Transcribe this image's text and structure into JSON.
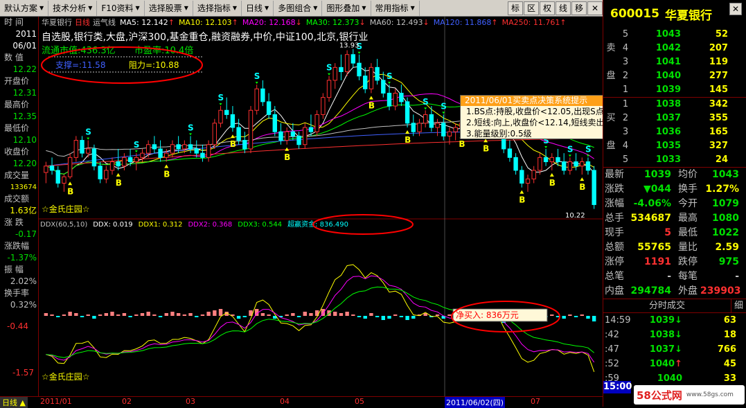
{
  "menubar": {
    "items": [
      "默认方案",
      "技术分析",
      "F10资料",
      "选择股票",
      "选择指标",
      "日线",
      "多图组合",
      "图形叠加",
      "常用指标"
    ],
    "tools": [
      "标",
      "区",
      "权",
      "线",
      "移",
      "✕"
    ]
  },
  "stock": {
    "code": "600015",
    "name": "华夏银行",
    "chart_title": "华夏银行",
    "period": "日线",
    "indicator": "运气线"
  },
  "ma": [
    {
      "label": "MA5: 12.142",
      "color": "#ffffff"
    },
    {
      "label": "MA10: 12.103",
      "color": "#ffff00"
    },
    {
      "label": "MA20: 12.168",
      "color": "#ff00ff"
    },
    {
      "label": "MA30: 12.373",
      "color": "#00ff00"
    },
    {
      "label": "MA60: 12.493",
      "color": "#c0c0c0"
    },
    {
      "label": "MA120: 11.868",
      "color": "#4060ff"
    },
    {
      "label": "MA250: 11.761",
      "color": "#ff3030"
    }
  ],
  "ma_arrows": [
    "↑",
    "↑",
    "↓",
    "↓",
    "↓",
    "↑",
    "↑"
  ],
  "info": {
    "line1": "自选股,银行类,大盘,沪深300,基金重仓,融资融券,中价,中证100,北京,银行业",
    "cap_label": "流通市值:436.3亿",
    "pe_label": "市盈率:10.4倍",
    "support_label": "支撑=:11.58",
    "resist_label": "阻力=:10.88",
    "peak_label": "13.93",
    "last_label": "10.22"
  },
  "left": {
    "time_k": "时  间",
    "date_year": "2011",
    "date_md": "06/01",
    "value_k": "数  值",
    "value_v": "12.22",
    "open_k": "开盘价",
    "open_v": "12.31",
    "high_k": "最高价",
    "high_v": "12.35",
    "low_k": "最低价",
    "low_v": "12.10",
    "close_k": "收盘价",
    "close_v": "12.20",
    "vol_k": "成交量",
    "vol_v": "133674",
    "amt_k": "成交额",
    "amt_v": "1.63亿",
    "chg_k": "涨  跌",
    "chg_v": "-0.17",
    "pct_k": "涨跌幅",
    "pct_v": "-1.37%",
    "amp_k": "振  幅",
    "amp_v": "2.02%",
    "turn_k": "换手率",
    "turn_v": "0.32%",
    "axis_low": "-0.44",
    "axis_bottom": "-1.57"
  },
  "ddx": {
    "name": "DDX(60,5,10)",
    "ddx": "DDX: 0.019",
    "ddx1": "DDX1: 0.312",
    "ddx2": "DDX2: 0.368",
    "ddx3": "DDX3: 0.544",
    "super": "超赢资金: 836.490",
    "net_buy": "净买入: 836万元"
  },
  "watermark": "☆金氏庄园☆",
  "popup": {
    "title": "2011/06/01买卖点决策系统提示",
    "l1": "1.BS点:持股,收盘价<12.05,出现S点",
    "l2": "2.短线:向上,收盘价<12.14,短线卖出",
    "l3": "3.能量级别:0.5级"
  },
  "xaxis": {
    "ticks": [
      "2011/01",
      "02",
      "03",
      "04",
      "05",
      "07"
    ],
    "cursor_date": "2011/06/02(四)",
    "tab": "日线"
  },
  "orderbook": {
    "sell_label": [
      "卖",
      "盘"
    ],
    "buy_label": [
      "买",
      "盘"
    ],
    "sells": [
      {
        "i": "5",
        "p": "1043",
        "v": "52"
      },
      {
        "i": "4",
        "p": "1042",
        "v": "207"
      },
      {
        "i": "3",
        "p": "1041",
        "v": "119"
      },
      {
        "i": "2",
        "p": "1040",
        "v": "277"
      },
      {
        "i": "1",
        "p": "1039",
        "v": "145"
      }
    ],
    "buys": [
      {
        "i": "1",
        "p": "1038",
        "v": "342"
      },
      {
        "i": "2",
        "p": "1037",
        "v": "355"
      },
      {
        "i": "3",
        "p": "1036",
        "v": "165"
      },
      {
        "i": "4",
        "p": "1035",
        "v": "327"
      },
      {
        "i": "5",
        "p": "1033",
        "v": "24"
      }
    ]
  },
  "stats": [
    {
      "k1": "最新",
      "v1": "1039",
      "c1": "#00e000",
      "k2": "均价",
      "v2": "1043",
      "c2": "#00e000"
    },
    {
      "k1": "涨跌",
      "v1": "▼044",
      "c1": "#00e000",
      "k2": "换手",
      "v2": "1.27%",
      "c2": "#ffff00"
    },
    {
      "k1": "涨幅",
      "v1": "-4.06%",
      "c1": "#00e000",
      "k2": "今开",
      "v2": "1079",
      "c2": "#00e000"
    },
    {
      "k1": "总手",
      "v1": "534687",
      "c1": "#ffff00",
      "k2": "最高",
      "v2": "1080",
      "c2": "#00e000"
    },
    {
      "k1": "现手",
      "v1": "5",
      "c1": "#ff3030",
      "k2": "最低",
      "v2": "1022",
      "c2": "#00e000"
    },
    {
      "k1": "总额",
      "v1": "55765",
      "c1": "#ffff00",
      "k2": "量比",
      "v2": "2.59",
      "c2": "#ffff00"
    },
    {
      "k1": "涨停",
      "v1": "1191",
      "c1": "#ff3030",
      "k2": "跌停",
      "v2": "975",
      "c2": "#00e000"
    },
    {
      "k1": "总笔",
      "v1": "-",
      "c1": "#c0c0c0",
      "k2": "每笔",
      "v2": "-",
      "c2": "#c0c0c0"
    },
    {
      "k1": "内盘",
      "v1": "294784",
      "c1": "#00e000",
      "k2": "外盘",
      "v2": "239903",
      "c2": "#ff3030"
    }
  ],
  "ticks_title": "分时成交",
  "ticks_btn": "细",
  "ticks": [
    {
      "t": "14:59",
      "p": "1039",
      "a": "↓",
      "c": "#00e000",
      "v": "63"
    },
    {
      "t": ":42",
      "p": "1038",
      "a": "↓",
      "c": "#00e000",
      "v": "18"
    },
    {
      "t": ":47",
      "p": "1037",
      "a": "↓",
      "c": "#00e000",
      "v": "766"
    },
    {
      "t": ":52",
      "p": "1040",
      "a": "↑",
      "c": "#ff3030",
      "v": "45"
    },
    {
      "t": ":59",
      "p": "1040",
      "a": "",
      "c": "#ff3030",
      "v": "33"
    }
  ],
  "time_box": "15:00",
  "site_logo": "58公式网",
  "site_url": "www.58gs.com",
  "chart_data": {
    "type": "candlestick",
    "price_range": [
      10.0,
      14.2
    ],
    "ma_colors": [
      "#ffffff",
      "#ffff00",
      "#ff00ff",
      "#00ff00",
      "#c0c0c0",
      "#4060ff",
      "#ff3030"
    ],
    "ohlc": [
      [
        11.05,
        11.3,
        10.8,
        11.2
      ],
      [
        11.2,
        11.4,
        11.0,
        11.1
      ],
      [
        11.1,
        11.2,
        10.7,
        10.8
      ],
      [
        10.8,
        11.0,
        10.6,
        10.95
      ],
      [
        10.95,
        11.5,
        10.9,
        11.4
      ],
      [
        11.4,
        11.9,
        11.3,
        11.8
      ],
      [
        11.8,
        11.9,
        11.4,
        11.5
      ],
      [
        11.5,
        11.8,
        11.4,
        11.6
      ],
      [
        11.6,
        11.7,
        11.1,
        11.2
      ],
      [
        11.2,
        11.3,
        10.8,
        10.9
      ],
      [
        10.9,
        11.2,
        10.8,
        11.1
      ],
      [
        11.1,
        11.4,
        11.0,
        11.3
      ],
      [
        11.3,
        11.6,
        11.1,
        11.2
      ],
      [
        11.2,
        11.5,
        11.1,
        11.4
      ],
      [
        11.4,
        11.6,
        11.2,
        11.3
      ],
      [
        11.3,
        11.5,
        11.1,
        11.4
      ],
      [
        11.4,
        11.6,
        11.3,
        11.5
      ],
      [
        11.5,
        11.8,
        11.4,
        11.7
      ],
      [
        11.7,
        11.9,
        11.5,
        11.6
      ],
      [
        11.6,
        11.8,
        11.3,
        11.4
      ],
      [
        11.4,
        11.6,
        11.3,
        11.5
      ],
      [
        11.5,
        11.8,
        11.4,
        11.7
      ],
      [
        11.7,
        11.9,
        11.5,
        11.6
      ],
      [
        11.6,
        11.8,
        11.5,
        11.7
      ],
      [
        11.7,
        11.9,
        11.5,
        11.6
      ],
      [
        11.6,
        11.8,
        11.4,
        11.5
      ],
      [
        11.5,
        11.7,
        11.3,
        11.4
      ],
      [
        11.4,
        11.8,
        11.3,
        11.7
      ],
      [
        11.7,
        12.3,
        11.6,
        12.2
      ],
      [
        12.2,
        12.6,
        12.1,
        12.5
      ],
      [
        12.5,
        12.8,
        12.3,
        12.4
      ],
      [
        12.4,
        12.6,
        12.0,
        12.1
      ],
      [
        12.1,
        12.3,
        11.7,
        11.8
      ],
      [
        11.8,
        12.0,
        11.5,
        11.6
      ],
      [
        11.6,
        12.6,
        11.5,
        12.5
      ],
      [
        12.5,
        13.1,
        12.4,
        13.0
      ],
      [
        13.0,
        13.2,
        12.6,
        12.7
      ],
      [
        12.7,
        12.9,
        12.3,
        12.4
      ],
      [
        12.4,
        12.6,
        11.9,
        12.0
      ],
      [
        12.0,
        12.2,
        11.7,
        11.8
      ],
      [
        11.8,
        12.1,
        11.7,
        12.0
      ],
      [
        12.0,
        12.2,
        11.8,
        11.9
      ],
      [
        11.9,
        12.0,
        11.6,
        11.7
      ],
      [
        11.7,
        12.2,
        11.6,
        12.1
      ],
      [
        12.1,
        12.4,
        11.9,
        12.0
      ],
      [
        12.0,
        12.5,
        11.9,
        12.4
      ],
      [
        12.4,
        12.9,
        12.3,
        12.8
      ],
      [
        12.8,
        13.3,
        12.7,
        13.2
      ],
      [
        13.2,
        13.6,
        13.0,
        13.5
      ],
      [
        13.5,
        13.8,
        13.2,
        13.4
      ],
      [
        13.4,
        13.9,
        13.3,
        13.8
      ],
      [
        13.8,
        13.93,
        13.5,
        13.6
      ],
      [
        13.6,
        13.8,
        13.2,
        13.3
      ],
      [
        13.3,
        13.5,
        12.9,
        13.0
      ],
      [
        13.0,
        13.6,
        12.9,
        13.5
      ],
      [
        13.5,
        13.7,
        13.1,
        13.2
      ],
      [
        13.2,
        13.4,
        12.8,
        12.9
      ],
      [
        12.9,
        13.1,
        12.5,
        12.6
      ],
      [
        12.6,
        13.0,
        12.5,
        12.9
      ],
      [
        12.9,
        13.1,
        12.6,
        12.7
      ],
      [
        12.7,
        12.8,
        12.1,
        12.2
      ],
      [
        12.2,
        12.4,
        11.9,
        12.0
      ],
      [
        12.0,
        12.3,
        11.9,
        12.2
      ],
      [
        12.2,
        12.5,
        12.1,
        12.4
      ],
      [
        12.4,
        12.6,
        12.0,
        12.1
      ],
      [
        12.1,
        12.3,
        11.9,
        12.2
      ],
      [
        12.2,
        12.4,
        11.8,
        11.9
      ],
      [
        11.9,
        12.1,
        11.7,
        12.0
      ],
      [
        12.0,
        12.2,
        11.8,
        12.1
      ],
      [
        12.1,
        12.3,
        12.0,
        12.2
      ],
      [
        12.2,
        12.4,
        12.0,
        12.3
      ],
      [
        12.3,
        12.5,
        12.1,
        12.2
      ],
      [
        12.2,
        12.4,
        11.9,
        12.0
      ],
      [
        12.0,
        12.3,
        11.9,
        12.2
      ],
      [
        12.2,
        12.5,
        12.1,
        12.4
      ],
      [
        12.4,
        12.6,
        12.1,
        12.2
      ],
      [
        12.2,
        12.4,
        11.5,
        11.6
      ],
      [
        11.6,
        11.8,
        11.3,
        11.4
      ],
      [
        11.4,
        11.5,
        11.0,
        11.1
      ],
      [
        11.1,
        11.2,
        10.7,
        10.8
      ],
      [
        10.8,
        11.0,
        10.6,
        10.9
      ],
      [
        10.9,
        11.2,
        10.8,
        11.1
      ],
      [
        11.1,
        11.5,
        11.0,
        11.4
      ],
      [
        11.4,
        11.6,
        11.2,
        11.3
      ],
      [
        11.3,
        11.5,
        11.1,
        11.4
      ],
      [
        11.4,
        11.6,
        11.2,
        11.3
      ],
      [
        11.3,
        11.5,
        11.0,
        11.1
      ],
      [
        11.1,
        11.4,
        11.0,
        11.3
      ],
      [
        11.3,
        11.5,
        11.1,
        11.2
      ],
      [
        11.2,
        11.4,
        11.0,
        11.3
      ],
      [
        11.3,
        11.4,
        11.0,
        11.1
      ],
      [
        11.1,
        11.2,
        10.2,
        10.3
      ]
    ],
    "ddx_bars": [
      0.2,
      0.1,
      -0.1,
      0.1,
      0.3,
      0.2,
      -0.1,
      0.1,
      -0.2,
      0.1,
      0.2,
      0.3,
      0.1,
      0.2,
      -0.1,
      0.1,
      0.2,
      0.3,
      0.1,
      -0.1,
      0.2,
      0.3,
      0.2,
      0.1,
      0.2,
      -0.1,
      0.1,
      0.3,
      0.4,
      0.5,
      0.3,
      0.1,
      -0.2,
      -0.1,
      0.4,
      0.5,
      0.2,
      0.1,
      -0.2,
      -0.1,
      0.1,
      0.2,
      -0.1,
      0.3,
      0.2,
      0.4,
      0.5,
      0.4,
      0.3,
      0.2,
      0.3,
      0.1,
      -0.1,
      -0.2,
      0.2,
      -0.1,
      -0.3,
      -0.2,
      0.1,
      -0.1,
      -0.3,
      -0.2,
      0.1,
      0.2,
      -0.1,
      0.1,
      -0.2,
      0.1,
      0.1,
      0.2,
      0.1,
      -0.1,
      -0.2,
      0.1,
      0.2,
      -0.1,
      -0.5,
      -0.3,
      -0.4,
      -0.3,
      -0.2,
      0.1,
      0.2,
      -0.1,
      0.1,
      -0.1,
      -0.2,
      0.1,
      -0.1,
      0.1,
      -0.2,
      -0.4
    ],
    "buy_signals": [
      4,
      12,
      20,
      31,
      40,
      54,
      60,
      69,
      73,
      79,
      84,
      89
    ],
    "sell_signals": [
      7,
      15,
      24,
      29,
      35,
      47,
      52,
      57,
      63,
      66,
      71,
      76,
      83,
      87,
      90
    ]
  }
}
